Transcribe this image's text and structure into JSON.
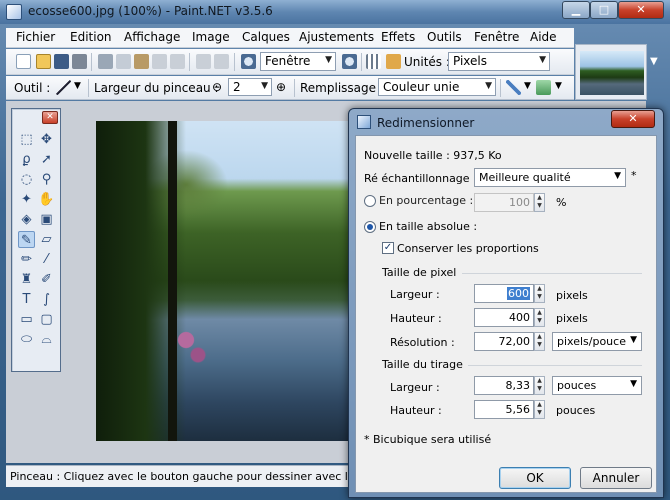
{
  "window": {
    "title": "ecosse600.jpg (100%) - Paint.NET v3.5.6",
    "min_label": "▁",
    "max_label": "□",
    "close_label": "✕"
  },
  "menu": [
    "Fichier",
    "Edition",
    "Affichage",
    "Image",
    "Calques",
    "Ajustements",
    "Effets",
    "Outils",
    "Fenêtre",
    "Aide"
  ],
  "toolbar1": {
    "view_combo": "Fenêtre",
    "units_label": "Unités :",
    "units_value": "Pixels"
  },
  "toolbar2": {
    "tool_label": "Outil :",
    "brush_width_label": "Largeur du pinceau :",
    "brush_width_value": "2",
    "fill_label": "Remplissage :",
    "fill_value": "Couleur unie"
  },
  "tools_window": {
    "close_label": "✕"
  },
  "status": {
    "text": "Pinceau : Cliquez avec le bouton gauche pour dessiner avec la couleur"
  },
  "dialog": {
    "title": "Redimensionner",
    "close_label": "✕",
    "new_size": "Nouvelle taille : 937,5 Ko",
    "resampling_label": "Ré échantillonnage :",
    "resampling_value": "Meilleure qualité",
    "resampling_note": "*",
    "by_percent_label": "En pourcentage :",
    "percent_value": "100",
    "percent_unit": "%",
    "absolute_label": "En taille absolue :",
    "keep_ratio_label": "Conserver les proportions",
    "pixel_size_header": "Taille de pixel",
    "width_label": "Largeur :",
    "width_value": "600",
    "width_unit": "pixels",
    "height_label": "Hauteur :",
    "height_value": "400",
    "height_unit": "pixels",
    "resolution_label": "Résolution :",
    "resolution_value": "72,00",
    "resolution_unit": "pixels/pouce",
    "print_size_header": "Taille du tirage",
    "print_width_label": "Largeur :",
    "print_width_value": "8,33",
    "print_width_unit": "pouces",
    "print_height_label": "Hauteur :",
    "print_height_value": "5,56",
    "print_height_unit": "pouces",
    "footnote": "* Bicubique sera utilisé",
    "ok_label": "OK",
    "cancel_label": "Annuler"
  }
}
